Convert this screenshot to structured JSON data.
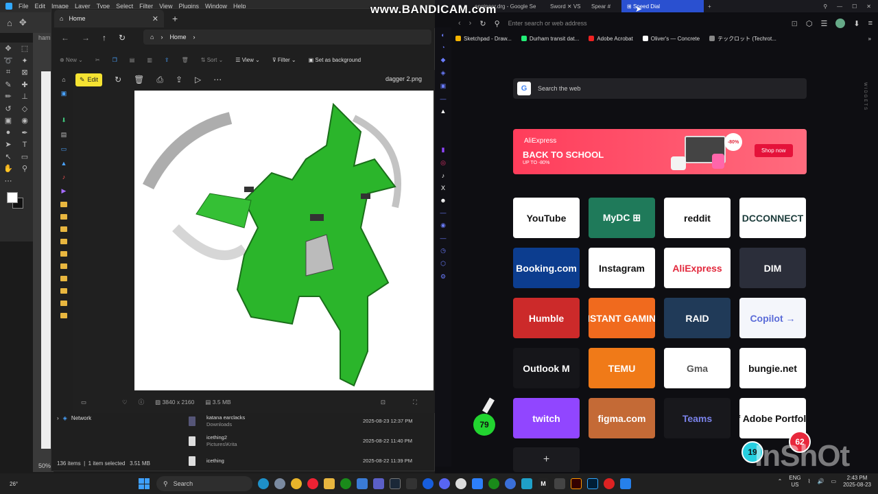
{
  "photoshop": {
    "menu": [
      "File",
      "Edit",
      "Image",
      "Layer",
      "Type",
      "Select",
      "Filter",
      "View",
      "Plugins",
      "Window",
      "Help"
    ],
    "doc_tab": "ham",
    "zoom": "50%"
  },
  "bandicam": "www.BANDICAM.com",
  "explorer": {
    "tab_title": "Home",
    "address": "Home",
    "commands": {
      "new": "New",
      "sort": "Sort",
      "view": "View",
      "filter": "Filter",
      "set_bg": "Set as background"
    },
    "network": "Network",
    "files": [
      {
        "name": "katana earclacks",
        "location": "Downloads",
        "date": "2025-08-23 12:37 PM"
      },
      {
        "name": "icething2",
        "location": "Pictures\\Krita",
        "date": "2025-08-22 11:40 PM"
      },
      {
        "name": "icething",
        "location": "",
        "date": "2025-08-22 11:39 PM"
      }
    ],
    "status_count": "136 items",
    "status_selected": "1 item selected",
    "status_size": "3.51 MB"
  },
  "photos": {
    "edit_label": "Edit",
    "filename": "dagger 2.png",
    "resolution": "3840 x 2160",
    "filesize": "3.5 MB"
  },
  "opera": {
    "tabs": [
      "engineer.drg - Google Se",
      "Sword ✕ VS",
      "Spear #",
      "Speed Dial"
    ],
    "address_placeholder": "Enter search or web address",
    "bookmarks": [
      "Sketchpad - Draw...",
      "Durham transit dat...",
      "Adobe Acrobat",
      "Oliver's — Concrete",
      "テックロット (Techrot..."
    ],
    "search_placeholder": "Search the web",
    "ad": {
      "brand": "AliExpress",
      "headline": "BACK TO SCHOOL",
      "sub": "UP TO -80%",
      "badge": "-80%",
      "cta": "Shop now"
    },
    "tiles": [
      {
        "label": "YouTube",
        "bg": "#ffffff",
        "fg": "#111111"
      },
      {
        "label": "MyDC ⊞",
        "bg": "#1f7a5a",
        "fg": "#ffffff"
      },
      {
        "label": "reddit",
        "bg": "#ffffff",
        "fg": "#111111"
      },
      {
        "label": "DCCONNECT",
        "bg": "#ffffff",
        "fg": "#1b3b3a"
      },
      {
        "label": "Booking.com",
        "bg": "#0c3d8f",
        "fg": "#ffffff"
      },
      {
        "label": "Instagram",
        "bg": "#ffffff",
        "fg": "#111111"
      },
      {
        "label": "AliExpress",
        "bg": "#ffffff",
        "fg": "#e2283c"
      },
      {
        "label": "DIM",
        "bg": "#2b2e3a",
        "fg": "#ffffff"
      },
      {
        "label": "Humble",
        "bg": "#cc2a2a",
        "fg": "#ffffff"
      },
      {
        "label": "INSTANT GAMING",
        "bg": "#f06a1e",
        "fg": "#ffffff"
      },
      {
        "label": "RAID",
        "bg": "#203a58",
        "fg": "#ffffff"
      },
      {
        "label": "Copilot →",
        "bg": "#f4f6fb",
        "fg": "#5a6bd8"
      },
      {
        "label": "Outlook M",
        "bg": "#16161a",
        "fg": "#ffffff"
      },
      {
        "label": "TEMU",
        "bg": "#f07a18",
        "fg": "#ffffff"
      },
      {
        "label": "Gma",
        "bg": "#ffffff",
        "fg": "#555555"
      },
      {
        "label": "bungie.net",
        "bg": "#ffffff",
        "fg": "#111111"
      },
      {
        "label": "twitch",
        "bg": "#9146ff",
        "fg": "#ffffff"
      },
      {
        "label": "figma.com",
        "bg": "#c46a36",
        "fg": "#ffffff"
      },
      {
        "label": "Teams",
        "bg": "#18181c",
        "fg": "#7b83eb"
      },
      {
        "label": "Pf Adobe Portfolio",
        "bg": "#ffffff",
        "fg": "#111111"
      }
    ],
    "add_tile": "+",
    "widgets_label": "WIDGETS"
  },
  "overlays": {
    "bubble_left": "79",
    "bubble_mid": "19",
    "bubble_right": "62",
    "watermark": "InShOt"
  },
  "taskbar": {
    "weather": "26°",
    "search": "Search",
    "lang": "ENG",
    "region": "US",
    "time": "2:43 PM",
    "date": "2025-08-23"
  }
}
